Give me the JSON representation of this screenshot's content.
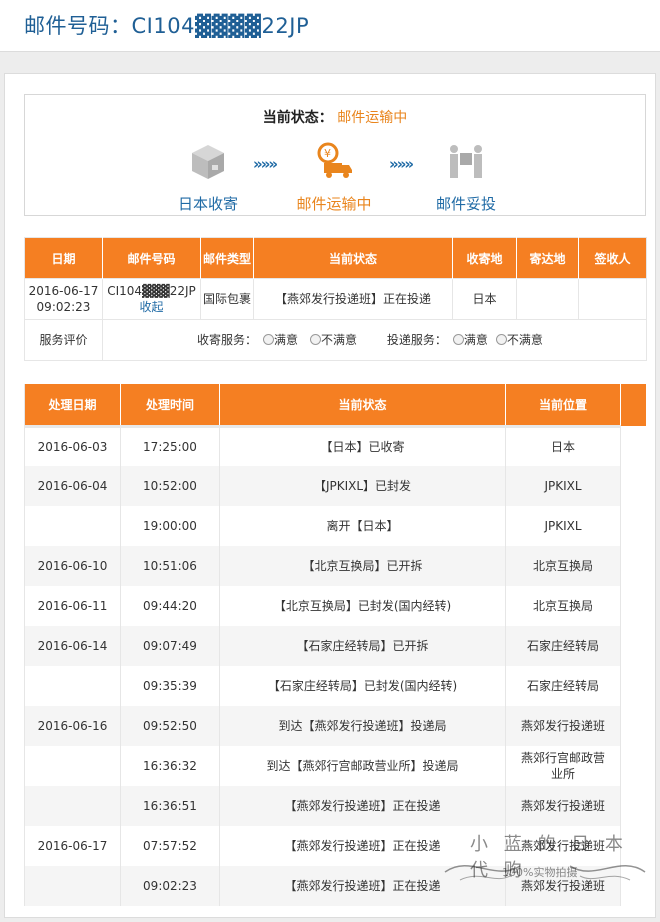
{
  "header": {
    "title": "邮件号码：CI104▓▓▓▓22JP"
  },
  "status": {
    "label": "当前状态：",
    "value": "邮件运输中",
    "steps": [
      {
        "label": "日本收寄",
        "icon": "package-icon"
      },
      {
        "label": "邮件运输中",
        "icon": "delivery-truck-icon"
      },
      {
        "label": "邮件妥投",
        "icon": "handover-icon"
      }
    ],
    "arrow": "»»»"
  },
  "summary": {
    "headers": [
      "日期",
      "邮件号码",
      "邮件类型",
      "当前状态",
      "收寄地",
      "寄达地",
      "签收人"
    ],
    "row": {
      "date": "2016-06-17 09:02:23",
      "number": "CI104▓▓▓22JP",
      "collapse": "收起",
      "type": "国际包裹",
      "status": "【燕郊发行投递班】正在投递",
      "origin": "日本",
      "destination": "",
      "signer": ""
    },
    "rating": {
      "label": "服务评价",
      "collect_label": "收寄服务：",
      "deliver_label": "投递服务：",
      "satisfied": "满意",
      "unsatisfied": "不满意"
    }
  },
  "tracking": {
    "headers": [
      "处理日期",
      "处理时间",
      "当前状态",
      "当前位置"
    ],
    "rows": [
      {
        "date": "2016-06-03",
        "time": "17:25:00",
        "status": "【日本】已收寄",
        "location": "日本"
      },
      {
        "date": "2016-06-04",
        "time": "10:52:00",
        "status": "【JPKIXL】已封发",
        "location": "JPKIXL"
      },
      {
        "date": "",
        "time": "19:00:00",
        "status": "离开【日本】",
        "location": "JPKIXL"
      },
      {
        "date": "2016-06-10",
        "time": "10:51:06",
        "status": "【北京互换局】已开拆",
        "location": "北京互换局"
      },
      {
        "date": "2016-06-11",
        "time": "09:44:20",
        "status": "【北京互换局】已封发(国内经转)",
        "location": "北京互换局"
      },
      {
        "date": "2016-06-14",
        "time": "09:07:49",
        "status": "【石家庄经转局】已开拆",
        "location": "石家庄经转局"
      },
      {
        "date": "",
        "time": "09:35:39",
        "status": "【石家庄经转局】已封发(国内经转)",
        "location": "石家庄经转局"
      },
      {
        "date": "2016-06-16",
        "time": "09:52:50",
        "status": "到达【燕郊发行投递班】投递局",
        "location": "燕郊发行投递班"
      },
      {
        "date": "",
        "time": "16:36:32",
        "status": "到达【燕郊行宫邮政营业所】投递局",
        "location": "燕郊行宫邮政营业所"
      },
      {
        "date": "",
        "time": "16:36:51",
        "status": "【燕郊发行投递班】正在投递",
        "location": "燕郊发行投递班"
      },
      {
        "date": "2016-06-17",
        "time": "07:57:52",
        "status": "【燕郊发行投递班】正在投递",
        "location": "燕郊发行投递班"
      },
      {
        "date": "",
        "time": "09:02:23",
        "status": "【燕郊发行投递班】正在投递",
        "location": "燕郊发行投递班"
      }
    ]
  },
  "watermark": {
    "line1": "小 蓝 的 日 本 代 购",
    "line2": "100%实物拍摄"
  },
  "colors": {
    "accent": "#f57f22",
    "link": "#1f6aa5",
    "highlight": "#e9851d"
  }
}
